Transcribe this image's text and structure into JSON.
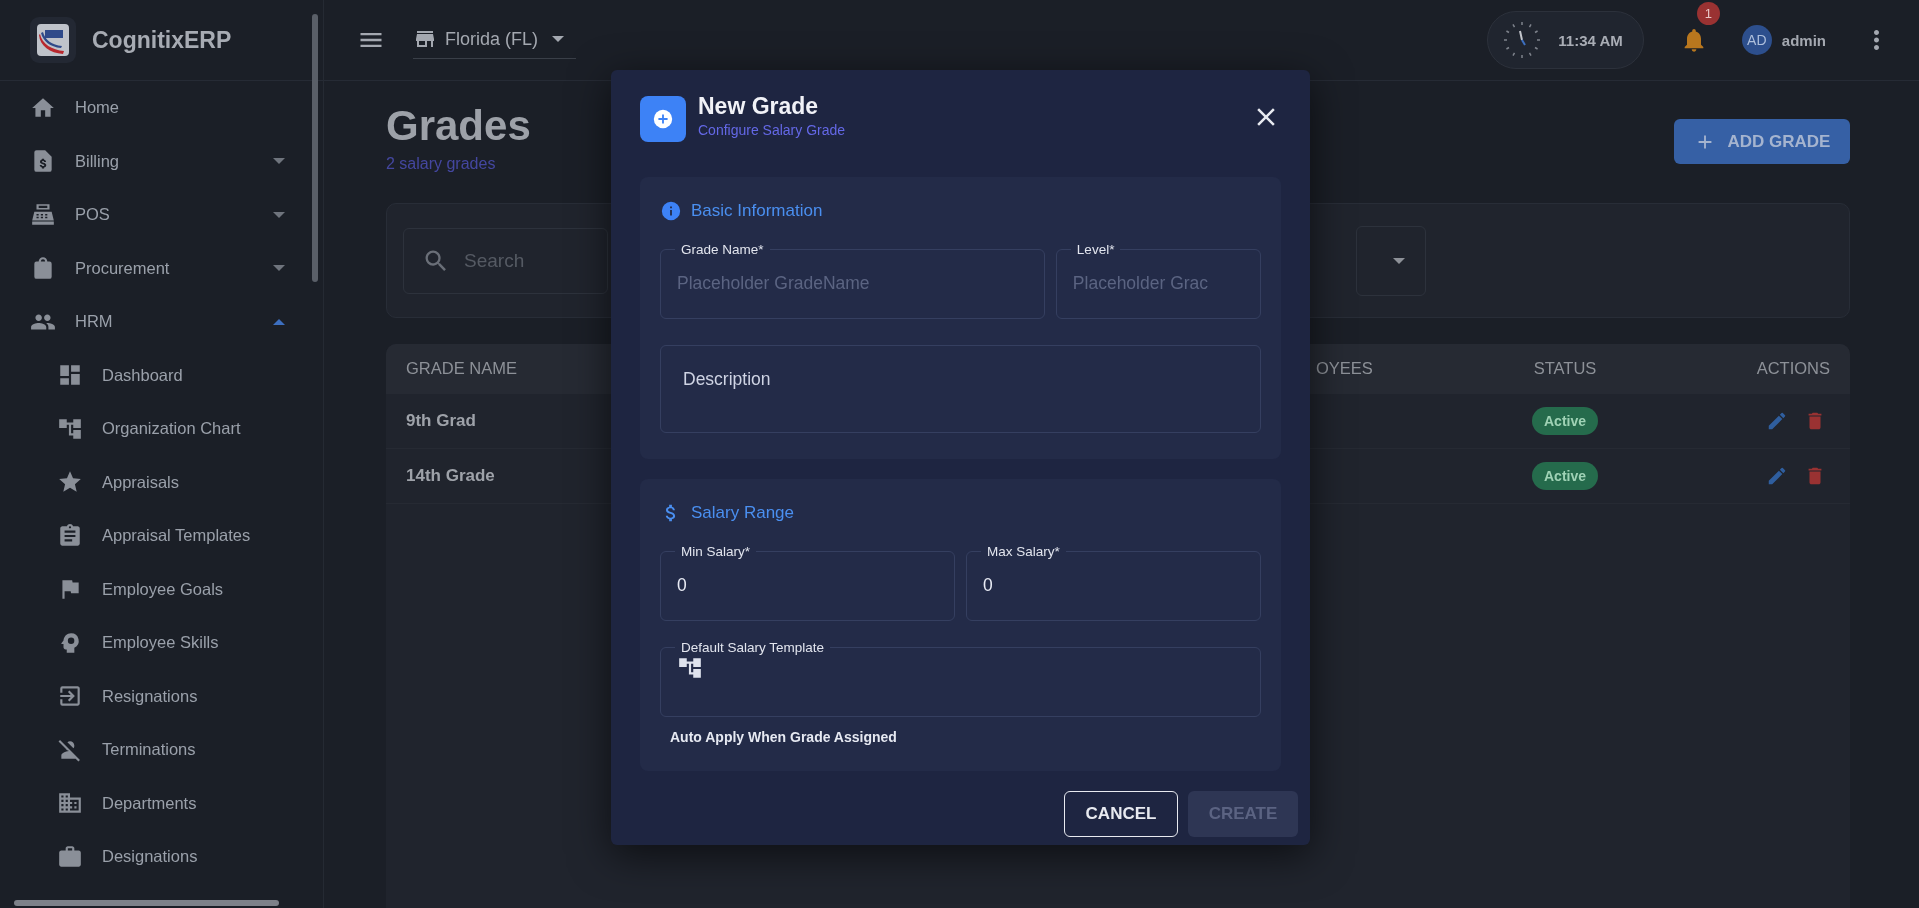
{
  "sidebar": {
    "brand": "CognitixERP",
    "items": [
      {
        "label": "Home"
      },
      {
        "label": "Billing",
        "expanded": false
      },
      {
        "label": "POS",
        "expanded": false
      },
      {
        "label": "Procurement",
        "expanded": false
      },
      {
        "label": "HRM",
        "expanded": true,
        "children": [
          {
            "label": "Dashboard",
            "selected": false
          },
          {
            "label": "Organization Chart",
            "selected": false
          },
          {
            "label": "Appraisals",
            "selected": false
          },
          {
            "label": "Appraisal Templates",
            "selected": false
          },
          {
            "label": "Employee Goals",
            "selected": false
          },
          {
            "label": "Employee Skills",
            "selected": false
          },
          {
            "label": "Resignations",
            "selected": false
          },
          {
            "label": "Terminations",
            "selected": false
          },
          {
            "label": "Departments",
            "selected": false
          },
          {
            "label": "Designations",
            "selected": false
          }
        ]
      }
    ]
  },
  "top_bar": {
    "store": "Florida (FL)",
    "time": "11:34 AM",
    "notification_count": "1",
    "user_initials": "AD",
    "user_name": "admin"
  },
  "page": {
    "title": "Grades",
    "subtitle": "2 salary grades",
    "add_button": "ADD GRADE",
    "search": {
      "placeholder": "Search"
    },
    "table": {
      "columns": [
        "GRADE NAME",
        "OYEES",
        "STATUS",
        "ACTIONS"
      ],
      "rows": [
        {
          "grade_name": "9th Grad",
          "status": "Active"
        },
        {
          "grade_name": "14th Grade",
          "status": "Active"
        }
      ]
    }
  },
  "dialog": {
    "title": "New Grade",
    "subtitle": "Configure Salary Grade",
    "basic_information": {
      "title": "Basic Information",
      "fields": [
        {
          "label": "Grade Name*",
          "placeholder": "Placeholder GradeName"
        },
        {
          "label": "Level*",
          "placeholder": "Placeholder Grac"
        }
      ],
      "description": {
        "placeholder": "Description"
      }
    },
    "salary_range": {
      "title": "Salary Range",
      "fields": [
        {
          "label": "Min Salary*",
          "value": "0"
        },
        {
          "label": "Max Salary*",
          "value": "0"
        }
      ],
      "template": {
        "label": "Default Salary Template"
      },
      "helper_text": "Auto Apply When Grade Assigned"
    },
    "buttons": [
      {
        "label": "CANCEL",
        "kind": "outlined",
        "disabled": false
      },
      {
        "label": "CREATE",
        "kind": "contained",
        "disabled": true
      }
    ]
  }
}
